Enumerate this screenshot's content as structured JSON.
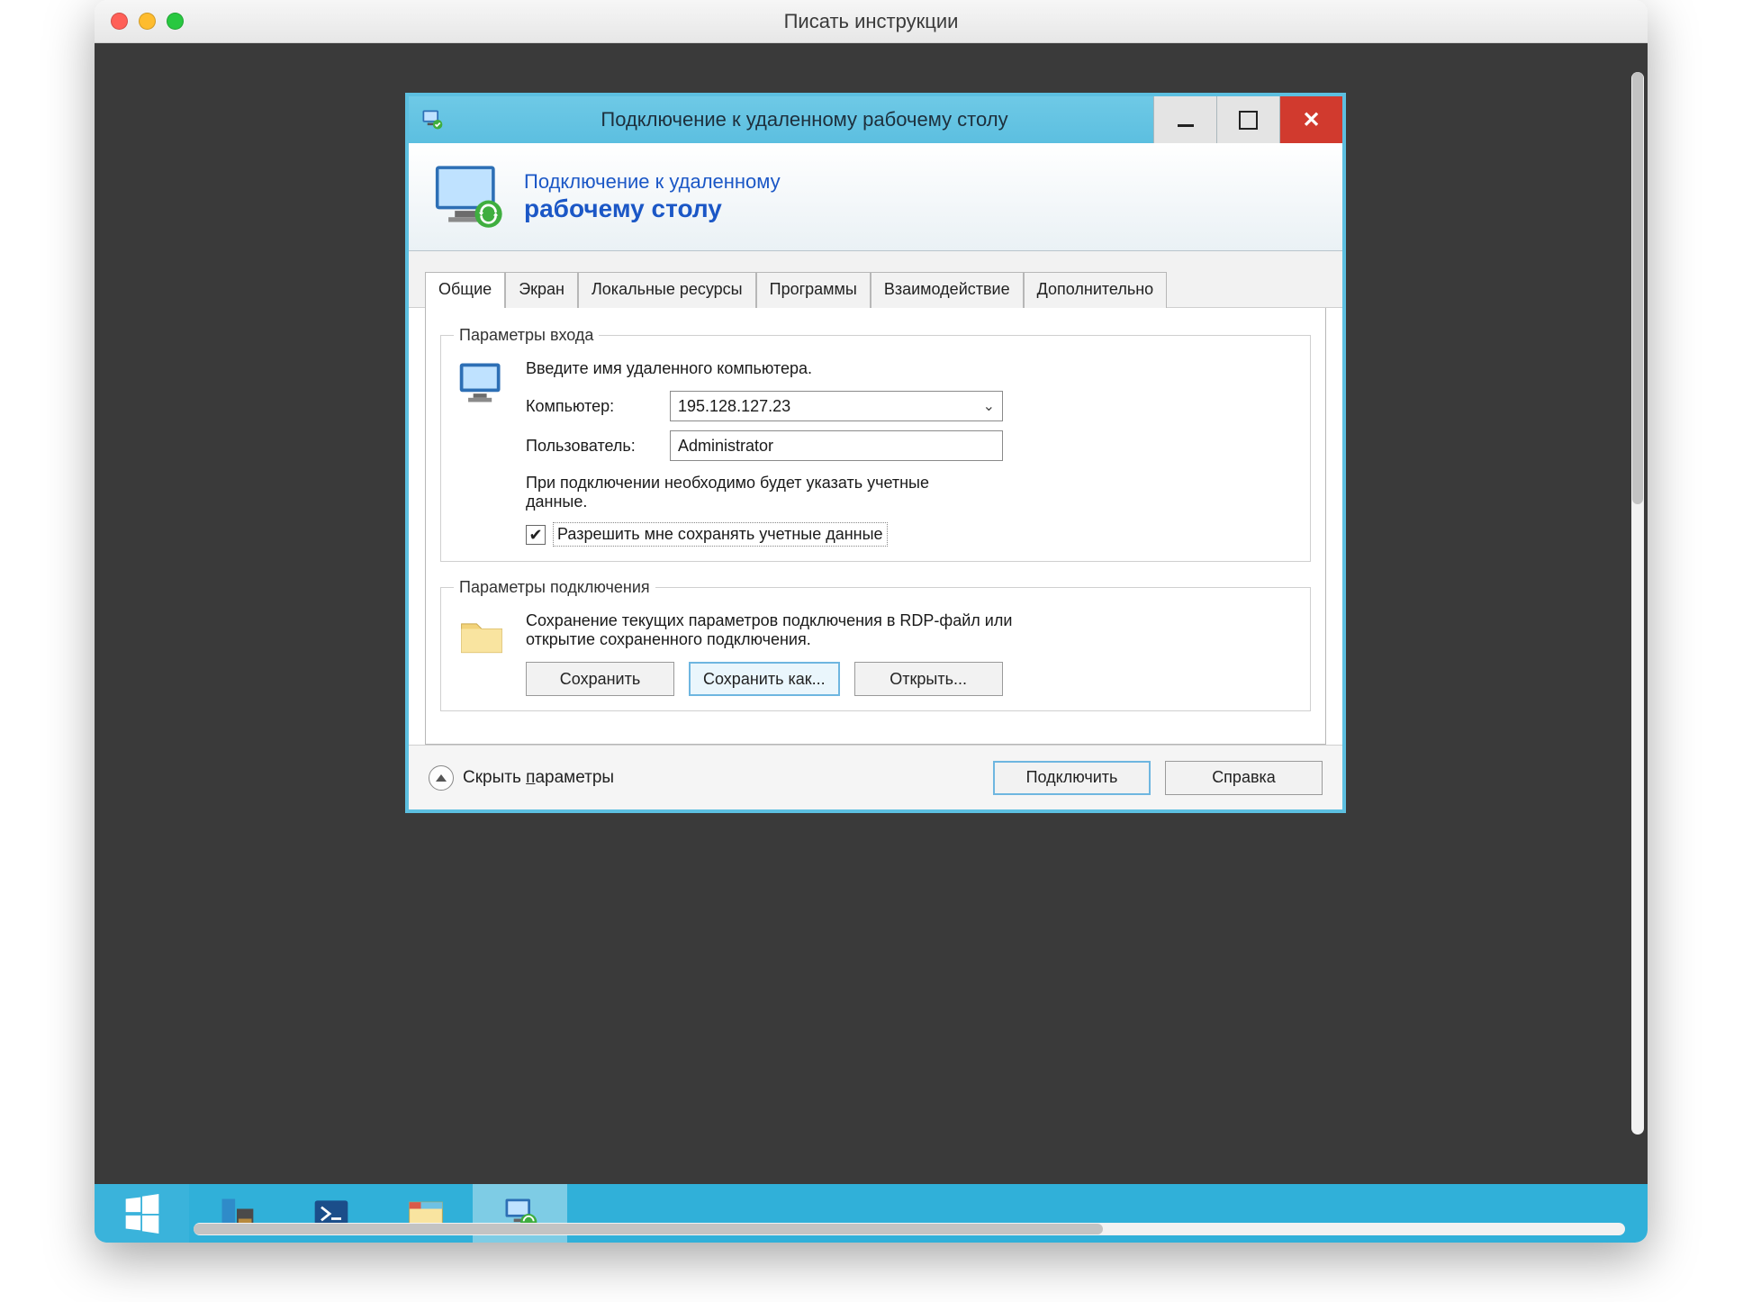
{
  "mac_window": {
    "title": "Писать инструкции"
  },
  "rdp": {
    "window_title": "Подключение к удаленному рабочему столу",
    "header_line1": "Подключение к удаленному",
    "header_line2": "рабочему столу",
    "tabs": {
      "general": "Общие",
      "display": "Экран",
      "local": "Локальные ресурсы",
      "programs": "Программы",
      "experience": "Взаимодействие",
      "advanced": "Дополнительно"
    },
    "login_group_title": "Параметры входа",
    "login_intro": "Введите имя удаленного компьютера.",
    "labels": {
      "computer": "Компьютер:",
      "user": "Пользователь:"
    },
    "values": {
      "computer": "195.128.127.23",
      "user": "Administrator"
    },
    "credentials_note": "При подключении необходимо будет указать учетные данные.",
    "save_credentials_label": "Разрешить мне сохранять учетные данные",
    "save_credentials_checked": true,
    "conn_group_title": "Параметры подключения",
    "conn_intro": "Сохранение текущих параметров подключения в RDP-файл или открытие сохраненного подключения.",
    "buttons": {
      "save": "Сохранить",
      "save_as": "Сохранить как...",
      "open": "Открыть...",
      "connect": "Подключить",
      "help": "Справка"
    },
    "hide_params_prefix": "Скрыть ",
    "hide_params_under": "п",
    "hide_params_rest": "араметры"
  }
}
